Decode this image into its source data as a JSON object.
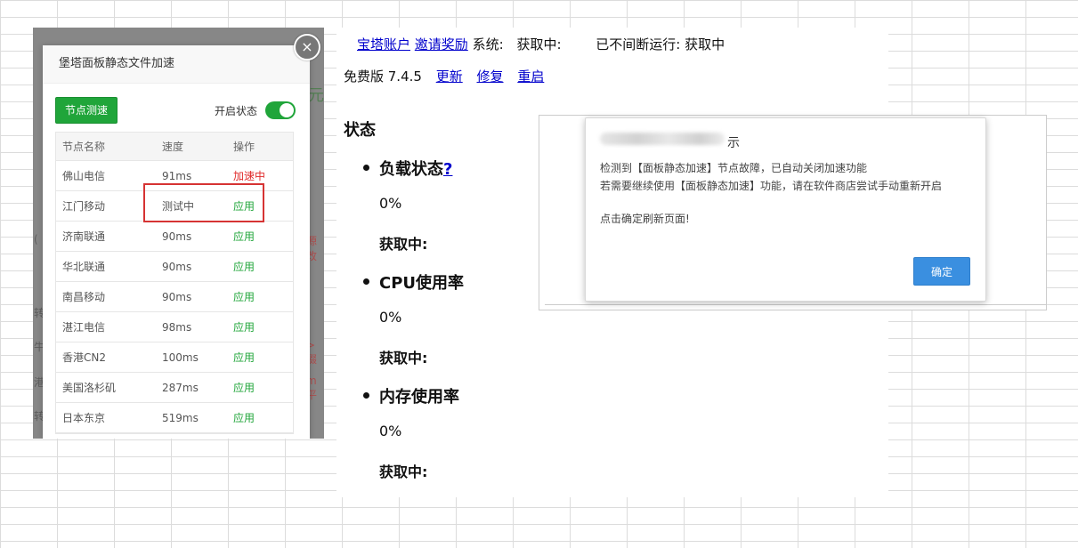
{
  "left_panel": {
    "bg_hints": [
      "元",
      "(",
      "源改",
      "转",
      "牛",
      "> 缀",
      "港",
      "m平",
      "转"
    ],
    "dialog": {
      "title": "堡塔面板静态文件加速",
      "close_glyph": "×",
      "test_button": "节点测速",
      "status_label": "开启状态",
      "status_enabled": true,
      "columns": [
        "节点名称",
        "速度",
        "操作"
      ],
      "rows": [
        {
          "name": "佛山电信",
          "speed": "91ms",
          "action": "加速中",
          "state": "accelerating"
        },
        {
          "name": "江门移动",
          "speed": "测试中",
          "action": "应用",
          "state": "apply"
        },
        {
          "name": "济南联通",
          "speed": "90ms",
          "action": "应用",
          "state": "apply"
        },
        {
          "name": "华北联通",
          "speed": "90ms",
          "action": "应用",
          "state": "apply"
        },
        {
          "name": "南昌移动",
          "speed": "90ms",
          "action": "应用",
          "state": "apply"
        },
        {
          "name": "湛江电信",
          "speed": "98ms",
          "action": "应用",
          "state": "apply"
        },
        {
          "name": "香港CN2",
          "speed": "100ms",
          "action": "应用",
          "state": "apply"
        },
        {
          "name": "美国洛杉矶",
          "speed": "287ms",
          "action": "应用",
          "state": "apply"
        },
        {
          "name": "日本东京",
          "speed": "519ms",
          "action": "应用",
          "state": "apply"
        }
      ]
    }
  },
  "status_page": {
    "account_link": "宝塔账户",
    "invite_link": "邀请奖励",
    "system_label": "系统:",
    "system_value": "获取中:",
    "uptime_label": "已不间断运行:",
    "uptime_value": "获取中",
    "version": "免费版 7.4.5",
    "update_link": "更新",
    "repair_link": "修复",
    "restart_link": "重启",
    "section_title": "状态",
    "load": {
      "label": "负载状态",
      "help": "?",
      "value": "0%",
      "fetch": "获取中:"
    },
    "cpu": {
      "label": "CPU使用率",
      "value": "0%",
      "fetch": "获取中:"
    },
    "memory": {
      "label": "内存使用率",
      "value": "0%",
      "fetch": "获取中:"
    }
  },
  "alert": {
    "title": "示",
    "line1": "检测到【面板静态加速】节点故障，已自动关闭加速功能",
    "line2": "若需要继续使用【面板静态加速】功能，请在软件商店尝试手动重新开启",
    "line3": "点击确定刷新页面!",
    "ok_button": "确定"
  },
  "colors": {
    "primary_green": "#20a53a",
    "danger_red": "#e02b2b",
    "link_blue": "#0000cc",
    "ok_blue": "#3a8fe0",
    "highlight_red": "#d63333"
  }
}
